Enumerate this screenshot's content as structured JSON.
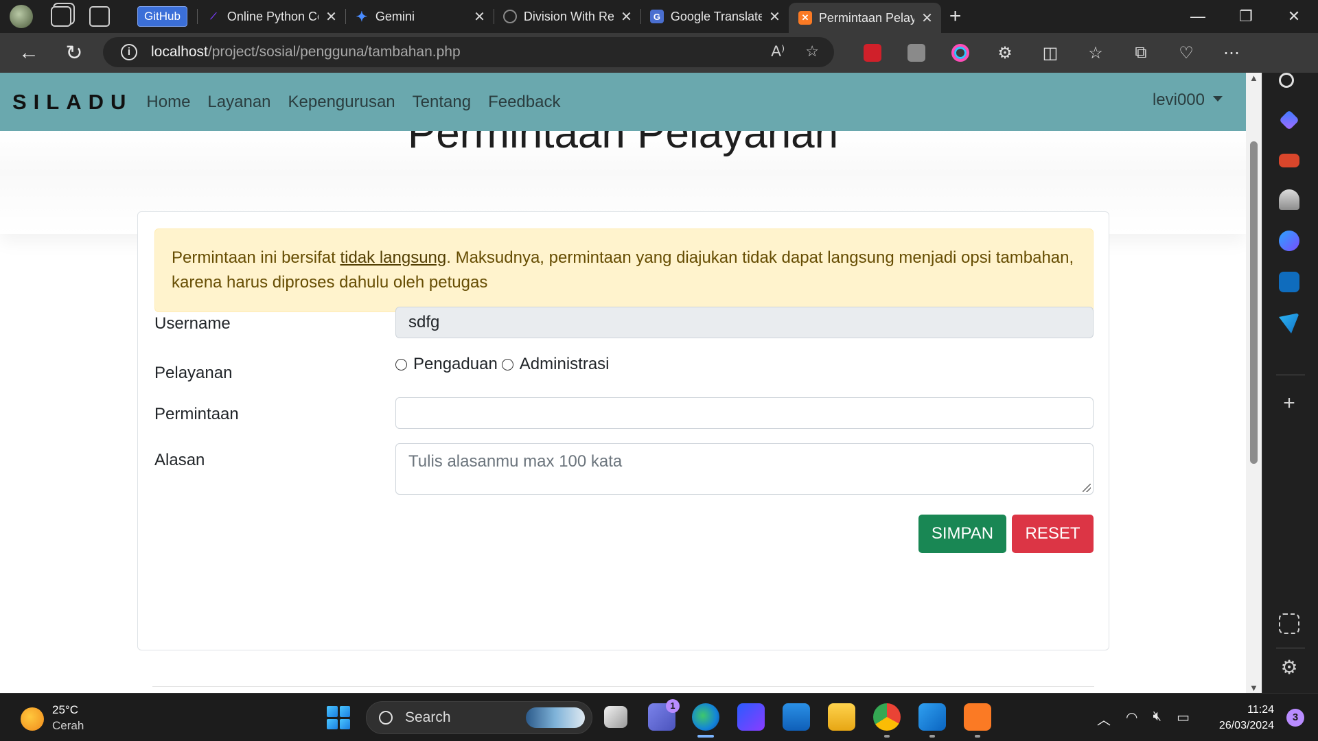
{
  "browser": {
    "github_chip": "GitHub",
    "tabs": [
      {
        "title": "Online Python Comp",
        "icon": "python-compiler-icon",
        "color": "#7a3cff"
      },
      {
        "title": "Gemini",
        "icon": "gemini-icon",
        "color": "#4a8cff"
      },
      {
        "title": "Division With Remair",
        "icon": "chatgpt-icon",
        "color": "#7a7a7a"
      },
      {
        "title": "Google Translate",
        "icon": "translate-icon",
        "color": "#4a6fd0"
      },
      {
        "title": "Permintaan Pelayana",
        "icon": "xampp-icon",
        "color": "#fb7a24"
      }
    ],
    "url_host": "localhost",
    "url_path": "/project/sosial/pengguna/tambahan.php"
  },
  "site": {
    "brand": "SILADU",
    "menu": [
      "Home",
      "Layanan",
      "Kepengurusan",
      "Tentang",
      "Feedback"
    ],
    "user": "levi000"
  },
  "page": {
    "title": "Permintaan Pelayanan",
    "alert": {
      "before": "Permintaan ini bersifat ",
      "link": "tidak langsung",
      "after": ". Maksudnya, permintaan yang diajukan tidak dapat langsung menjadi opsi tambahan, karena harus diproses dahulu oleh petugas"
    },
    "form": {
      "username_label": "Username",
      "username_value": "sdfg",
      "pelayanan_label": "Pelayanan",
      "options": [
        "Pengaduan",
        "Administrasi"
      ],
      "permintaan_label": "Permintaan",
      "permintaan_value": "",
      "alasan_label": "Alasan",
      "alasan_placeholder": "Tulis alasanmu max 100 kata",
      "save_label": "SIMPAN",
      "reset_label": "RESET"
    },
    "colors": {
      "navbar": "#6aa8ae",
      "save": "#198754",
      "reset": "#dc3545",
      "alert_bg": "#fff3cd"
    }
  },
  "taskbar": {
    "weather_temp": "25°C",
    "weather_desc": "Cerah",
    "search_label": "Search",
    "chat_badge": "1",
    "time": "11:24",
    "date": "26/03/2024",
    "notifications": "3"
  }
}
